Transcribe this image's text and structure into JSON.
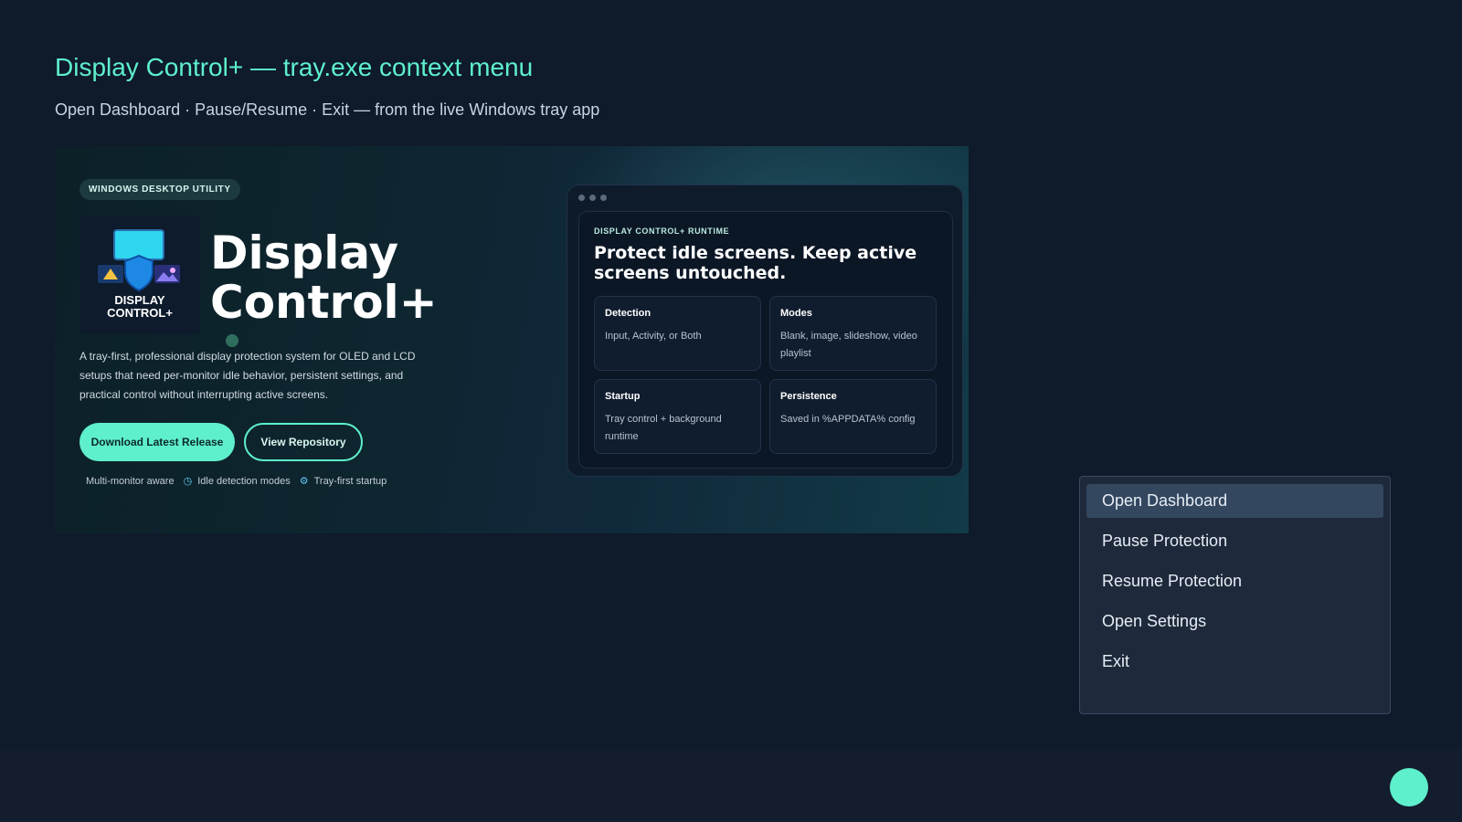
{
  "page": {
    "title": "Display Control+ — tray.exe context menu",
    "subtitle": "Open Dashboard · Pause/Resume · Exit — from the live Windows tray app"
  },
  "hero": {
    "badge": "WINDOWS DESKTOP UTILITY",
    "logo_line1": "DISPLAY",
    "logo_line2": "CONTROL+",
    "product_name_line1": "Display",
    "product_name_line2": "Control+",
    "description": "A tray-first, professional display protection system for OLED and LCD setups that need per-monitor idle behavior, persistent settings, and practical control without interrupting active screens.",
    "primary_button": "Download Latest Release",
    "secondary_button": "View Repository",
    "features": [
      "Multi-monitor aware",
      "Idle detection modes",
      "Tray-first startup"
    ]
  },
  "runtime_window": {
    "label": "DISPLAY CONTROL+ RUNTIME",
    "headline": "Protect idle screens. Keep active screens untouched.",
    "cards": [
      {
        "title": "Detection",
        "body": "Input, Activity, or Both"
      },
      {
        "title": "Modes",
        "body": "Blank, image, slideshow, video playlist"
      },
      {
        "title": "Startup",
        "body": "Tray control + background runtime"
      },
      {
        "title": "Persistence",
        "body": "Saved in %APPDATA% config"
      }
    ]
  },
  "context_menu": {
    "items": [
      {
        "label": "Open Dashboard",
        "highlighted": true
      },
      {
        "label": "Pause Protection",
        "highlighted": false
      },
      {
        "label": "Resume Protection",
        "highlighted": false
      },
      {
        "label": "Open Settings",
        "highlighted": false
      },
      {
        "label": "Exit",
        "highlighted": false
      }
    ]
  },
  "colors": {
    "accent": "#5ef0cc",
    "background": "#0f1a2b",
    "menu_background": "#1e293b",
    "menu_highlight": "#33475f"
  }
}
